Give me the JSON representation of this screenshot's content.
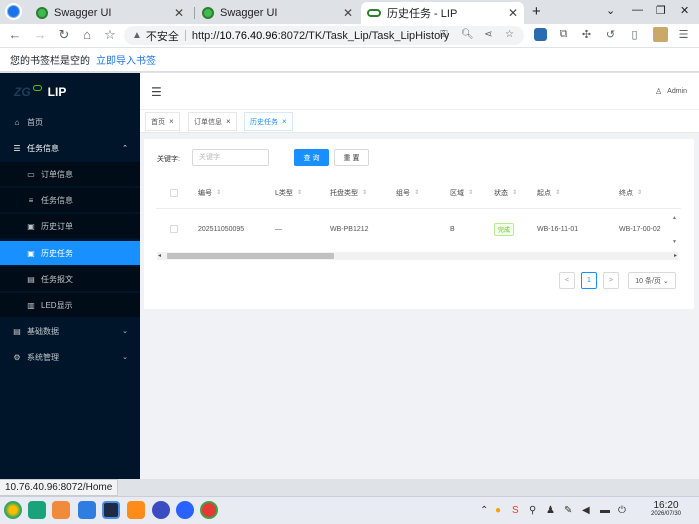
{
  "browser": {
    "tabs": [
      {
        "title": "Swagger UI"
      },
      {
        "title": "Swagger UI"
      },
      {
        "title": "历史任务 - LIP"
      }
    ],
    "address": {
      "security_label": "不安全",
      "url_host": "10.76.40.96",
      "url_rest": ":8072/TK/Task_Lip/Task_LipHistory",
      "url_prefix": "http://"
    },
    "bookmarks": {
      "empty_text": "您的书签栏是空的",
      "import_link": "立即导入书签"
    },
    "status_url": "10.76.40.96:8072/Home"
  },
  "app": {
    "logo_prefix": "ZG",
    "logo_text": "LIP",
    "user": "Admin",
    "menu": {
      "home": "首页",
      "task_info": "任务信息",
      "order_info": "订单信息",
      "task_info_sub": "任务信息",
      "history_order": "历史订单",
      "history_task": "历史任务",
      "task_report": "任务报文",
      "led_display": "LED显示",
      "base_data": "基础数据",
      "system_mgmt": "系统管理"
    },
    "page_tabs": [
      {
        "label": "首页"
      },
      {
        "label": "订单信息"
      },
      {
        "label": "历史任务"
      }
    ],
    "search": {
      "keyword_label": "关键字:",
      "placeholder": "关键字",
      "query_button": "查 询",
      "reset_button": "重 置"
    },
    "table": {
      "columns": [
        "编号",
        "L类型",
        "托盘类型",
        "组号",
        "区域",
        "状态",
        "起点",
        "终点"
      ],
      "rows": [
        {
          "id": "202511050095",
          "l_type": "—",
          "pallet_type": "WB-PB1212",
          "group": "",
          "area": "B",
          "status": "完成",
          "start": "WB-16-11-01",
          "end": "WB-17-00-02"
        }
      ]
    },
    "pagination": {
      "prev": "<",
      "page": "1",
      "next": ">",
      "page_size": "10 条/页"
    }
  },
  "taskbar": {
    "time": "16:20",
    "date": "2026/07/30"
  }
}
